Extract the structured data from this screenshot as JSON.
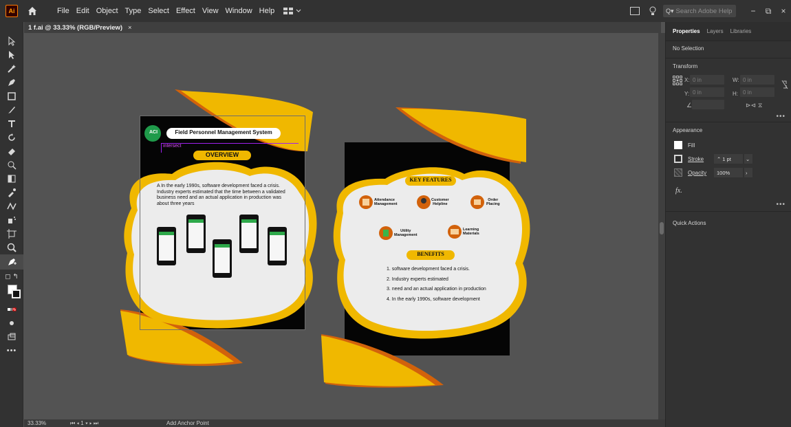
{
  "app": {
    "logo": "Ai"
  },
  "menu": [
    "File",
    "Edit",
    "Object",
    "Type",
    "Select",
    "Effect",
    "View",
    "Window",
    "Help"
  ],
  "search": {
    "placeholder": "Search Adobe Help"
  },
  "document_tab": {
    "title": "1 f.ai @ 33.33% (RGB/Preview)",
    "close": "×"
  },
  "status": {
    "zoom": "33.33%",
    "artboard": "1",
    "mode": "Add Anchor Point"
  },
  "panel": {
    "tabs": [
      "Properties",
      "Layers",
      "Libraries"
    ],
    "selection": "No Selection",
    "transform": {
      "title": "Transform",
      "x_label": "X:",
      "y_label": "Y:",
      "w_label": "W:",
      "h_label": "H:",
      "unit": "0 in"
    },
    "appearance": {
      "title": "Appearance",
      "fill": "Fill",
      "stroke": "Stroke",
      "stroke_value": "1 pt",
      "opacity": "Opacity",
      "opacity_value": "100%",
      "fx": "fx."
    },
    "quick_actions": "Quick Actions"
  },
  "artboard1": {
    "logo": "ACI",
    "title": "Field Personnel Management System",
    "smart_guide": "intersect",
    "overview": "OVERVIEW",
    "body": "A In the early 1990s, software development faced a crisis. Industry experts estimated that the time between a validated business need and an actual application in production was about three years"
  },
  "artboard2": {
    "key_features": "KEY FEATURES",
    "features": [
      {
        "line1": "Attendance",
        "line2": "Management"
      },
      {
        "line1": "Customer",
        "line2": "Helpline"
      },
      {
        "line1": "Order",
        "line2": "Placing"
      },
      {
        "line1": "Utility",
        "line2": "Management"
      },
      {
        "line1": "Learning",
        "line2": "Materials"
      }
    ],
    "benefits": "BENEFITS",
    "benefit_items": [
      "1.  software development faced a crisis.",
      "2.  Industry experts estimated",
      "3.  need and an actual application in production",
      "4.  In the early 1990s, software development"
    ]
  },
  "colors": {
    "accent_yellow": "#f0b800",
    "accent_orange": "#d2620b",
    "artboard_black": "#050505",
    "blob_fill": "#ececec",
    "ui_dark": "#323232",
    "canvas": "#535353"
  }
}
